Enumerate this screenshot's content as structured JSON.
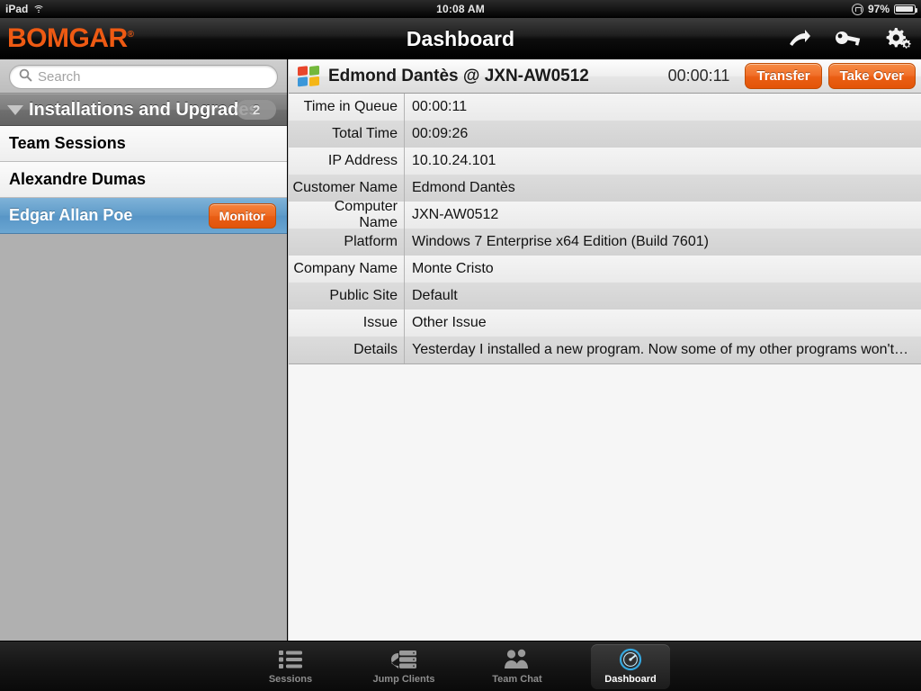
{
  "statusbar": {
    "device": "iPad",
    "time": "10:08 AM",
    "battery": "97%",
    "wifi_icon": "wifi-icon",
    "rotation_lock_icon": "rotation-lock-icon",
    "battery_icon": "battery-icon",
    "battery_percent": 97
  },
  "navbar": {
    "logo": "BOMGAR",
    "logo_trademark": "®",
    "title": "Dashboard",
    "icons": [
      {
        "name": "forward-arrow-icon"
      },
      {
        "name": "key-icon"
      },
      {
        "name": "gear-icon"
      }
    ]
  },
  "sidebar": {
    "search": {
      "placeholder": "Search",
      "value": "",
      "icon": "search-icon"
    },
    "section": {
      "title": "Installations and Upgrades",
      "count": "2",
      "expanded": true,
      "disclosure_icon": "triangle-down-icon"
    },
    "rows": [
      {
        "label": "Team Sessions",
        "selected": false,
        "action": null
      },
      {
        "label": "Alexandre Dumas",
        "selected": false,
        "action": null
      },
      {
        "label": "Edgar Allan Poe",
        "selected": true,
        "action": "Monitor"
      }
    ]
  },
  "detail": {
    "platform_icon": "windows-logo-icon",
    "title": "Edmond Dantès @ JXN-AW0512",
    "timer": "00:00:11",
    "buttons": [
      {
        "label": "Transfer",
        "name": "transfer-button"
      },
      {
        "label": "Take Over",
        "name": "take-over-button"
      }
    ],
    "rows": [
      {
        "label": "Time in Queue",
        "value": "00:00:11"
      },
      {
        "label": "Total Time",
        "value": "00:09:26"
      },
      {
        "label": "IP Address",
        "value": "10.10.24.101"
      },
      {
        "label": "Customer Name",
        "value": "Edmond Dantès"
      },
      {
        "label": "Computer Name",
        "value": "JXN-AW0512"
      },
      {
        "label": "Platform",
        "value": "Windows 7 Enterprise x64 Edition (Build 7601)"
      },
      {
        "label": "Company Name",
        "value": "Monte Cristo"
      },
      {
        "label": "Public Site",
        "value": "Default"
      },
      {
        "label": "Issue",
        "value": "Other Issue"
      },
      {
        "label": "Details",
        "value": "Yesterday I installed a new program. Now some of my other programs won't…"
      }
    ]
  },
  "tabbar": {
    "tabs": [
      {
        "label": "Sessions",
        "icon": "list-icon",
        "active": false
      },
      {
        "label": "Jump Clients",
        "icon": "server-icon",
        "active": false
      },
      {
        "label": "Team Chat",
        "icon": "people-icon",
        "active": false
      },
      {
        "label": "Dashboard",
        "icon": "gauge-icon",
        "active": true
      }
    ]
  },
  "colors": {
    "brand_orange": "#ee5a13",
    "selection_blue": "#5e9bc9",
    "active_tab_blue": "#35a8e0",
    "sidebar_bg": "#b0b0b0"
  }
}
